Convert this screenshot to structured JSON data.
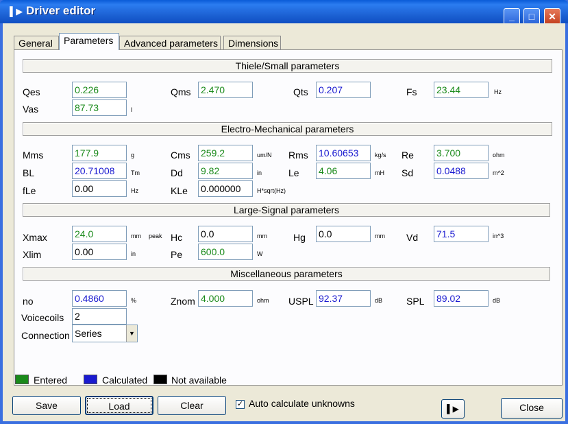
{
  "window": {
    "title": "Driver editor"
  },
  "tabs": [
    {
      "label": "General"
    },
    {
      "label": "Parameters"
    },
    {
      "label": "Advanced parameters"
    },
    {
      "label": "Dimensions"
    }
  ],
  "sections": {
    "ts": "Thiele/Small parameters",
    "em": "Electro-Mechanical parameters",
    "ls": "Large-Signal parameters",
    "misc": "Miscellaneous parameters"
  },
  "fields": {
    "qes": {
      "label": "Qes",
      "value": "0.226",
      "unit": ""
    },
    "qms": {
      "label": "Qms",
      "value": "2.470",
      "unit": ""
    },
    "qts": {
      "label": "Qts",
      "value": "0.207",
      "unit": ""
    },
    "fs": {
      "label": "Fs",
      "value": "23.44",
      "unit": "Hz"
    },
    "vas": {
      "label": "Vas",
      "value": "87.73",
      "unit": "l"
    },
    "mms": {
      "label": "Mms",
      "value": "177.9",
      "unit": "g"
    },
    "cms": {
      "label": "Cms",
      "value": "259.2",
      "unit": "um/N"
    },
    "rms": {
      "label": "Rms",
      "value": "10.60653",
      "unit": "kg/s"
    },
    "re": {
      "label": "Re",
      "value": "3.700",
      "unit": "ohm"
    },
    "bl": {
      "label": "BL",
      "value": "20.71008",
      "unit": "Tm"
    },
    "dd": {
      "label": "Dd",
      "value": "9.82",
      "unit": "in"
    },
    "le": {
      "label": "Le",
      "value": "4.06",
      "unit": "mH"
    },
    "sd": {
      "label": "Sd",
      "value": "0.0488",
      "unit": "m^2"
    },
    "fle": {
      "label": "fLe",
      "value": "0.00",
      "unit": "Hz"
    },
    "kle": {
      "label": "KLe",
      "value": "0.000000",
      "unit": "H*sqrt(Hz)"
    },
    "xmax": {
      "label": "Xmax",
      "value": "24.0",
      "unit": "mm",
      "unit2": "peak"
    },
    "hc": {
      "label": "Hc",
      "value": "0.0",
      "unit": "mm"
    },
    "hg": {
      "label": "Hg",
      "value": "0.0",
      "unit": "mm"
    },
    "vd": {
      "label": "Vd",
      "value": "71.5",
      "unit": "in^3"
    },
    "xlim": {
      "label": "Xlim",
      "value": "0.00",
      "unit": "in"
    },
    "pe": {
      "label": "Pe",
      "value": "600.0",
      "unit": "W"
    },
    "no": {
      "label": "no",
      "value": "0.4860",
      "unit": "%"
    },
    "znom": {
      "label": "Znom",
      "value": "4.000",
      "unit": "ohm"
    },
    "uspl": {
      "label": "USPL",
      "value": "92.37",
      "unit": "dB"
    },
    "spl": {
      "label": "SPL",
      "value": "89.02",
      "unit": "dB"
    },
    "voicecoils": {
      "label": "Voicecoils",
      "value": "2"
    },
    "connection": {
      "label": "Connection",
      "value": "Series"
    }
  },
  "legend": {
    "entered": {
      "label": "Entered",
      "color": "#1a8a1a"
    },
    "calculated": {
      "label": "Calculated",
      "color": "#1a1ad0"
    },
    "na": {
      "label": "Not available",
      "color": "#000000"
    }
  },
  "buttons": {
    "save": "Save",
    "load": "Load",
    "clear": "Clear",
    "close": "Close",
    "auto_calc": "Auto calculate unknowns"
  }
}
